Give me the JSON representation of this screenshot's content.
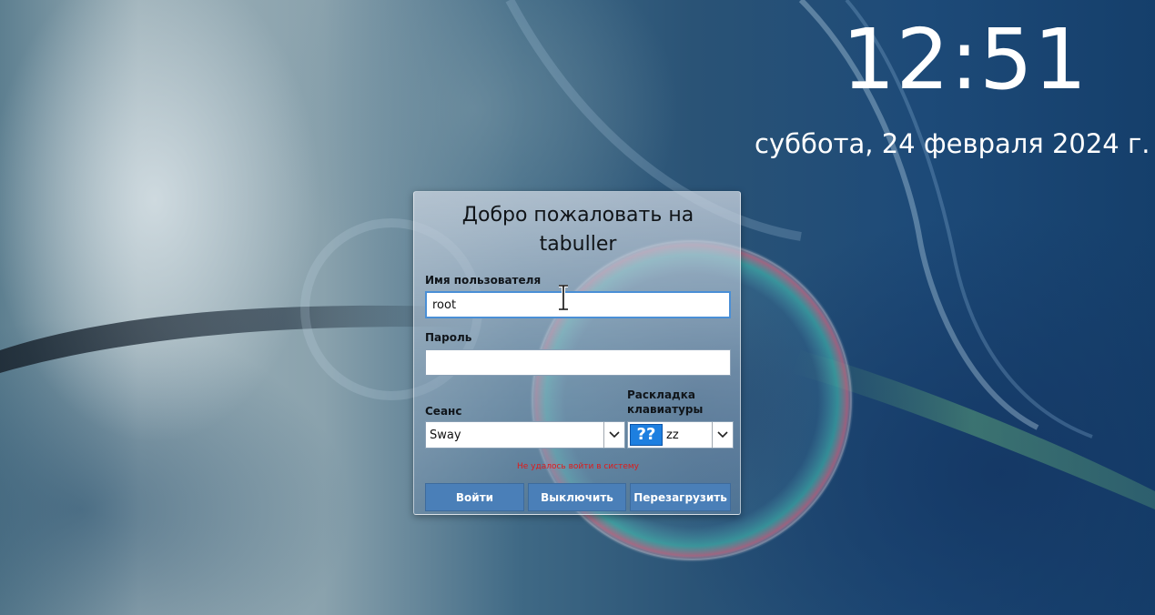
{
  "clock": {
    "time": "12:51",
    "date": "суббота, 24 февраля 2024 г."
  },
  "login": {
    "welcome_line1": "Добро пожаловать на",
    "welcome_line2": "tabuller",
    "username": {
      "label": "Имя пользователя",
      "value": "root"
    },
    "password": {
      "label": "Пароль",
      "value": ""
    },
    "session": {
      "label": "Сеанс",
      "selected": "Sway"
    },
    "keyboard": {
      "label_line1": "Раскладка",
      "label_line2": "клавиатуры",
      "flag_text": "??",
      "selected": "zz"
    },
    "error_message": "Не удалось войти в систему",
    "buttons": {
      "login": "Войти",
      "shutdown": "Выключить",
      "reboot": "Перезагрузить"
    }
  },
  "colors": {
    "button": "#4a7fb8",
    "error": "#e01a1a",
    "focus_border": "#4a8fd6",
    "flag": "#1d7fe0"
  },
  "icons": {
    "dropdown": "chevron-down-icon",
    "cursor": "text-cursor-icon"
  }
}
